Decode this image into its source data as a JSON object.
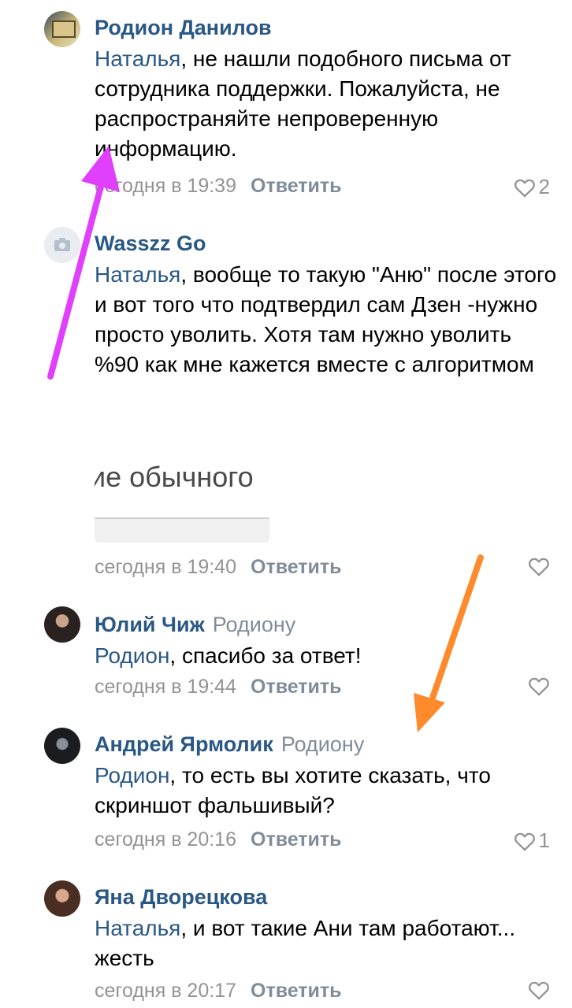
{
  "comments": [
    {
      "author": "Родион Данилов",
      "reply_to": "",
      "mention": "Наталья",
      "text": ", не нашли подобного письма от сотрудника поддержки. Пожалуйста, не распространяйте непроверенную информацию.",
      "time": "сегодня в 19:39",
      "reply_label": "Ответить",
      "likes": "2"
    },
    {
      "author": "Wasszz Go",
      "reply_to": "",
      "mention": "Наталья",
      "text": ", вообще то такую \"Аню\" после этого и вот того что подтвердил сам Дзен -нужно просто уволить. Хотя там нужно уволить %90 как мне кажется вместе с алгоритмом",
      "attachment_text": "ие обычного",
      "time": "сегодня в 19:40",
      "reply_label": "Ответить",
      "likes": ""
    },
    {
      "author": "Юлий Чиж",
      "reply_to": "Родиону",
      "mention": "Родион",
      "text": ", спасибо за ответ!",
      "time": "сегодня в 19:44",
      "reply_label": "Ответить",
      "likes": ""
    },
    {
      "author": "Андрей Ярмолик",
      "reply_to": "Родиону",
      "mention": "Родион",
      "text": ", то есть вы хотите сказать, что скриншот фальшивый?",
      "time": "сегодня в 20:16",
      "reply_label": "Ответить",
      "likes": "1"
    },
    {
      "author": "Яна Дворецкова",
      "reply_to": "",
      "mention": "Наталья",
      "text": ", и вот такие Ани там работают... жесть",
      "time": "сегодня в 20:17",
      "reply_label": "Ответить",
      "likes": ""
    }
  ],
  "colors": {
    "link": "#2a5885",
    "meta": "#939393",
    "arrow_magenta": "#e040fb",
    "arrow_orange": "#ff8a2b"
  },
  "icons": [
    "heart-icon",
    "camera-icon",
    "arrow-annotation"
  ]
}
